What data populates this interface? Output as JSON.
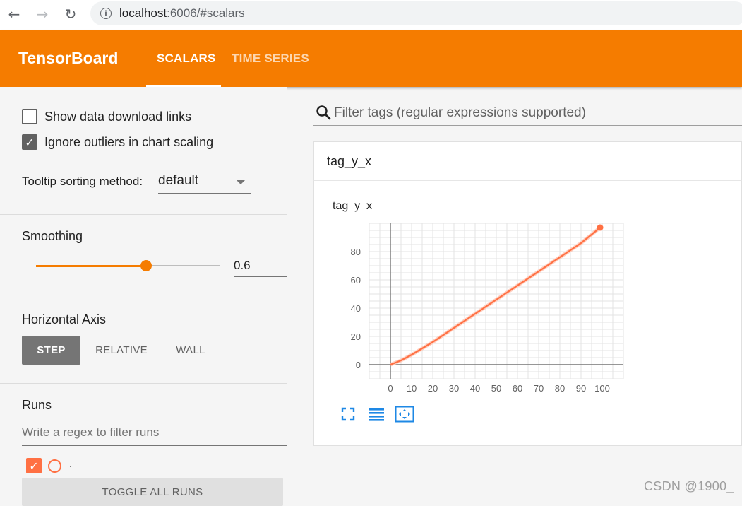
{
  "browser": {
    "url_host": "localhost",
    "url_rest": ":6006/#scalars"
  },
  "header": {
    "logo": "TensorBoard",
    "tabs": [
      {
        "label": "SCALARS"
      },
      {
        "label": "TIME SERIES"
      }
    ]
  },
  "sidebar": {
    "show_download_label": "Show data download links",
    "ignore_outliers_label": "Ignore outliers in chart scaling",
    "tooltip_label": "Tooltip sorting method:",
    "tooltip_value": "default",
    "smoothing_title": "Smoothing",
    "smoothing_value": "0.6",
    "smoothing_fraction": 0.6,
    "axis_title": "Horizontal Axis",
    "axis_buttons": [
      {
        "label": "STEP"
      },
      {
        "label": "RELATIVE"
      },
      {
        "label": "WALL"
      }
    ],
    "runs_title": "Runs",
    "runs_filter_placeholder": "Write a regex to filter runs",
    "run_name": ".",
    "toggle_all_label": "TOGGLE ALL RUNS"
  },
  "main": {
    "filter_placeholder": "Filter tags (regular expressions supported)",
    "card_title": "tag_y_x",
    "chart_title": "tag_y_x"
  },
  "colors": {
    "accent": "#f57c00",
    "series": "#ff7043"
  },
  "watermark": "CSDN @1900_",
  "chart_data": {
    "type": "line",
    "title": "tag_y_x",
    "xlabel": "",
    "ylabel": "",
    "x_ticks": [
      0,
      10,
      20,
      30,
      40,
      50,
      60,
      70,
      80,
      90,
      100
    ],
    "y_ticks": [
      0,
      20,
      40,
      60,
      80
    ],
    "xlim": [
      -10,
      110
    ],
    "ylim": [
      -10,
      100
    ],
    "grid": true,
    "series": [
      {
        "x": [
          0,
          5,
          10,
          20,
          30,
          40,
          50,
          60,
          70,
          80,
          90,
          99
        ],
        "y": [
          0,
          3,
          7,
          16,
          26,
          36,
          46,
          56,
          66,
          76,
          86,
          97
        ]
      }
    ]
  }
}
